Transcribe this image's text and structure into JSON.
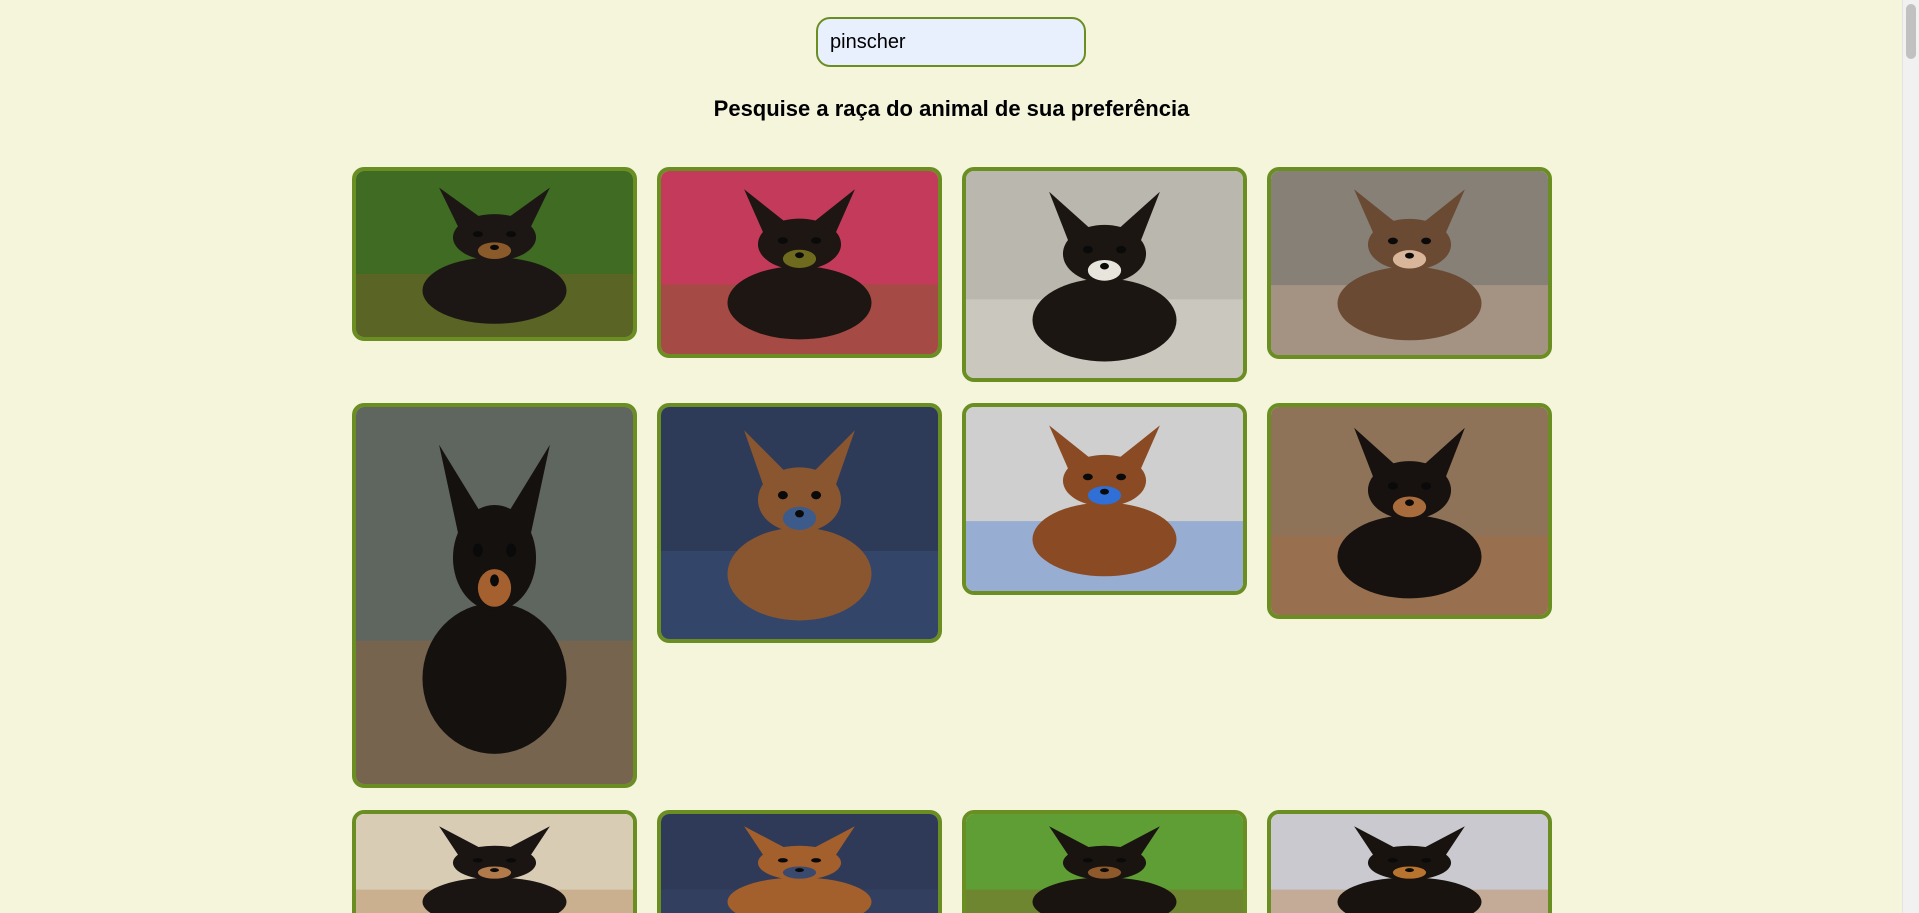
{
  "search": {
    "value": "pinscher"
  },
  "headline": "Pesquise a raça do animal de sua preferência",
  "photos": [
    {
      "bg": "#3f6b22",
      "body": "#1c1714",
      "accent": "#8a5a2b"
    },
    {
      "bg": "#c43a5a",
      "body": "#1d1612",
      "accent": "#6e6a1e"
    },
    {
      "bg": "#b9b7ae",
      "body": "#1b1611",
      "accent": "#e8e6dc"
    },
    {
      "bg": "#878077",
      "body": "#6a4a32",
      "accent": "#d9b59a"
    },
    {
      "bg": "#5f6660",
      "body": "#15110e",
      "accent": "#a5602f"
    },
    {
      "bg": "#2e3b58",
      "body": "#8a5630",
      "accent": "#3d5b8a"
    },
    {
      "bg": "#cfcfcf",
      "body": "#8a4a23",
      "accent": "#2f6fd6"
    },
    {
      "bg": "#8f7359",
      "body": "#17120f",
      "accent": "#a86b3b"
    },
    {
      "bg": "#d9ccb4",
      "body": "#1a1512",
      "accent": "#b07a4a"
    },
    {
      "bg": "#2f3a58",
      "body": "#a35f2c",
      "accent": "#3a4a6e"
    },
    {
      "bg": "#5f9e35",
      "body": "#1a1410",
      "accent": "#8f5a2b"
    },
    {
      "bg": "#c9c9cf",
      "body": "#18130f",
      "accent": "#b8742f"
    }
  ]
}
